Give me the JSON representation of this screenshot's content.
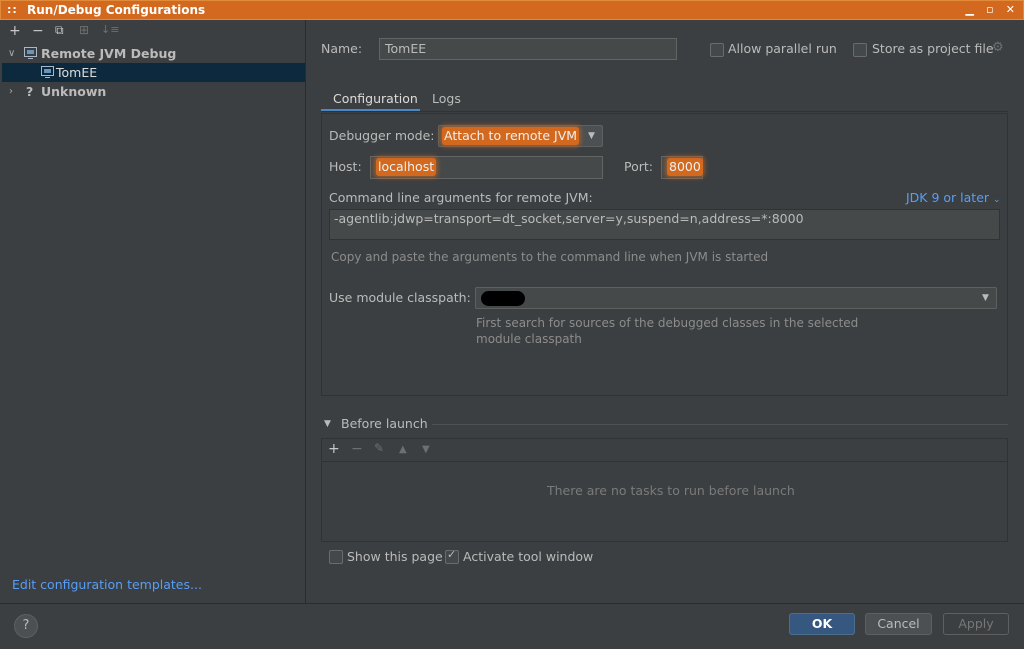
{
  "window": {
    "title": "Run/Debug Configurations",
    "controls": [
      "▁",
      "▫",
      "✕"
    ]
  },
  "left": {
    "toolbar": [
      "+",
      "−",
      "⧉",
      "⊞",
      "↓≡"
    ],
    "tree": [
      {
        "label": "Remote JVM Debug",
        "expanded": true,
        "icon": "remote-jvm-icon"
      },
      {
        "label": "TomEE",
        "selected": true,
        "icon": "config-icon"
      },
      {
        "label": "Unknown",
        "expanded": false,
        "icon": "question-icon"
      }
    ],
    "edit_templates": "Edit configuration templates..."
  },
  "right": {
    "name_label": "Name:",
    "name_value": "TomEE",
    "allow_parallel": "Allow parallel run",
    "store_project": "Store as project file",
    "tabs": [
      "Configuration",
      "Logs"
    ],
    "active_tab": "Configuration",
    "debugger_mode_label": "Debugger mode:",
    "debugger_mode_value": "Attach to remote JVM",
    "host_label": "Host:",
    "host_value": "localhost",
    "port_label": "Port:",
    "port_value": "8000",
    "cmd_label": "Command line arguments for remote JVM:",
    "jdk_link": "JDK 9 or later",
    "cmd_value": "-agentlib:jdwp=transport=dt_socket,server=y,suspend=n,address=*:8000",
    "cmd_hint": "Copy and paste the arguments to the command line when JVM is started",
    "module_label": "Use module classpath:",
    "module_hint_1": "First search for sources of the debugged classes in the selected",
    "module_hint_2": "module classpath",
    "before_launch": "Before launch",
    "before_launch_tools": [
      "+",
      "−",
      "✎",
      "▲",
      "▼"
    ],
    "no_tasks": "There are no tasks to run before launch",
    "show_page": "Show this page",
    "show_page_checked": false,
    "activate_tool": "Activate tool window",
    "activate_tool_checked": true
  },
  "buttons": {
    "help": "?",
    "ok": "OK",
    "cancel": "Cancel",
    "apply": "Apply"
  },
  "colors": {
    "highlight": "#d2691e",
    "link": "#589df6",
    "accent": "#4a88c7"
  }
}
